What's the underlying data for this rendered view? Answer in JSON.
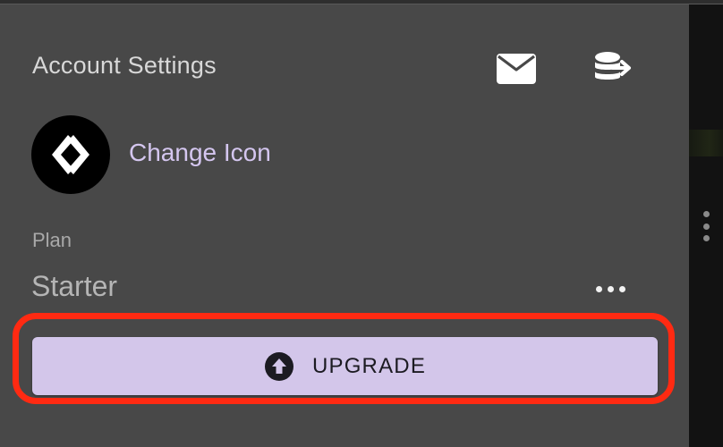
{
  "header": {
    "title": "Account Settings",
    "mail_icon": "mail-icon",
    "export_icon": "database-export-icon"
  },
  "profile": {
    "avatar_icon": "app-logo-icon",
    "change_icon_label": "Change Icon"
  },
  "plan": {
    "label": "Plan",
    "value": "Starter",
    "more_icon": "more-horizontal-icon"
  },
  "upgrade": {
    "label": "UPGRADE",
    "icon": "arrow-up-circle-icon"
  },
  "colors": {
    "panel_bg": "#484848",
    "accent": "#d3c6ea",
    "link": "#d4c6ef",
    "highlight": "#ff2a12"
  }
}
